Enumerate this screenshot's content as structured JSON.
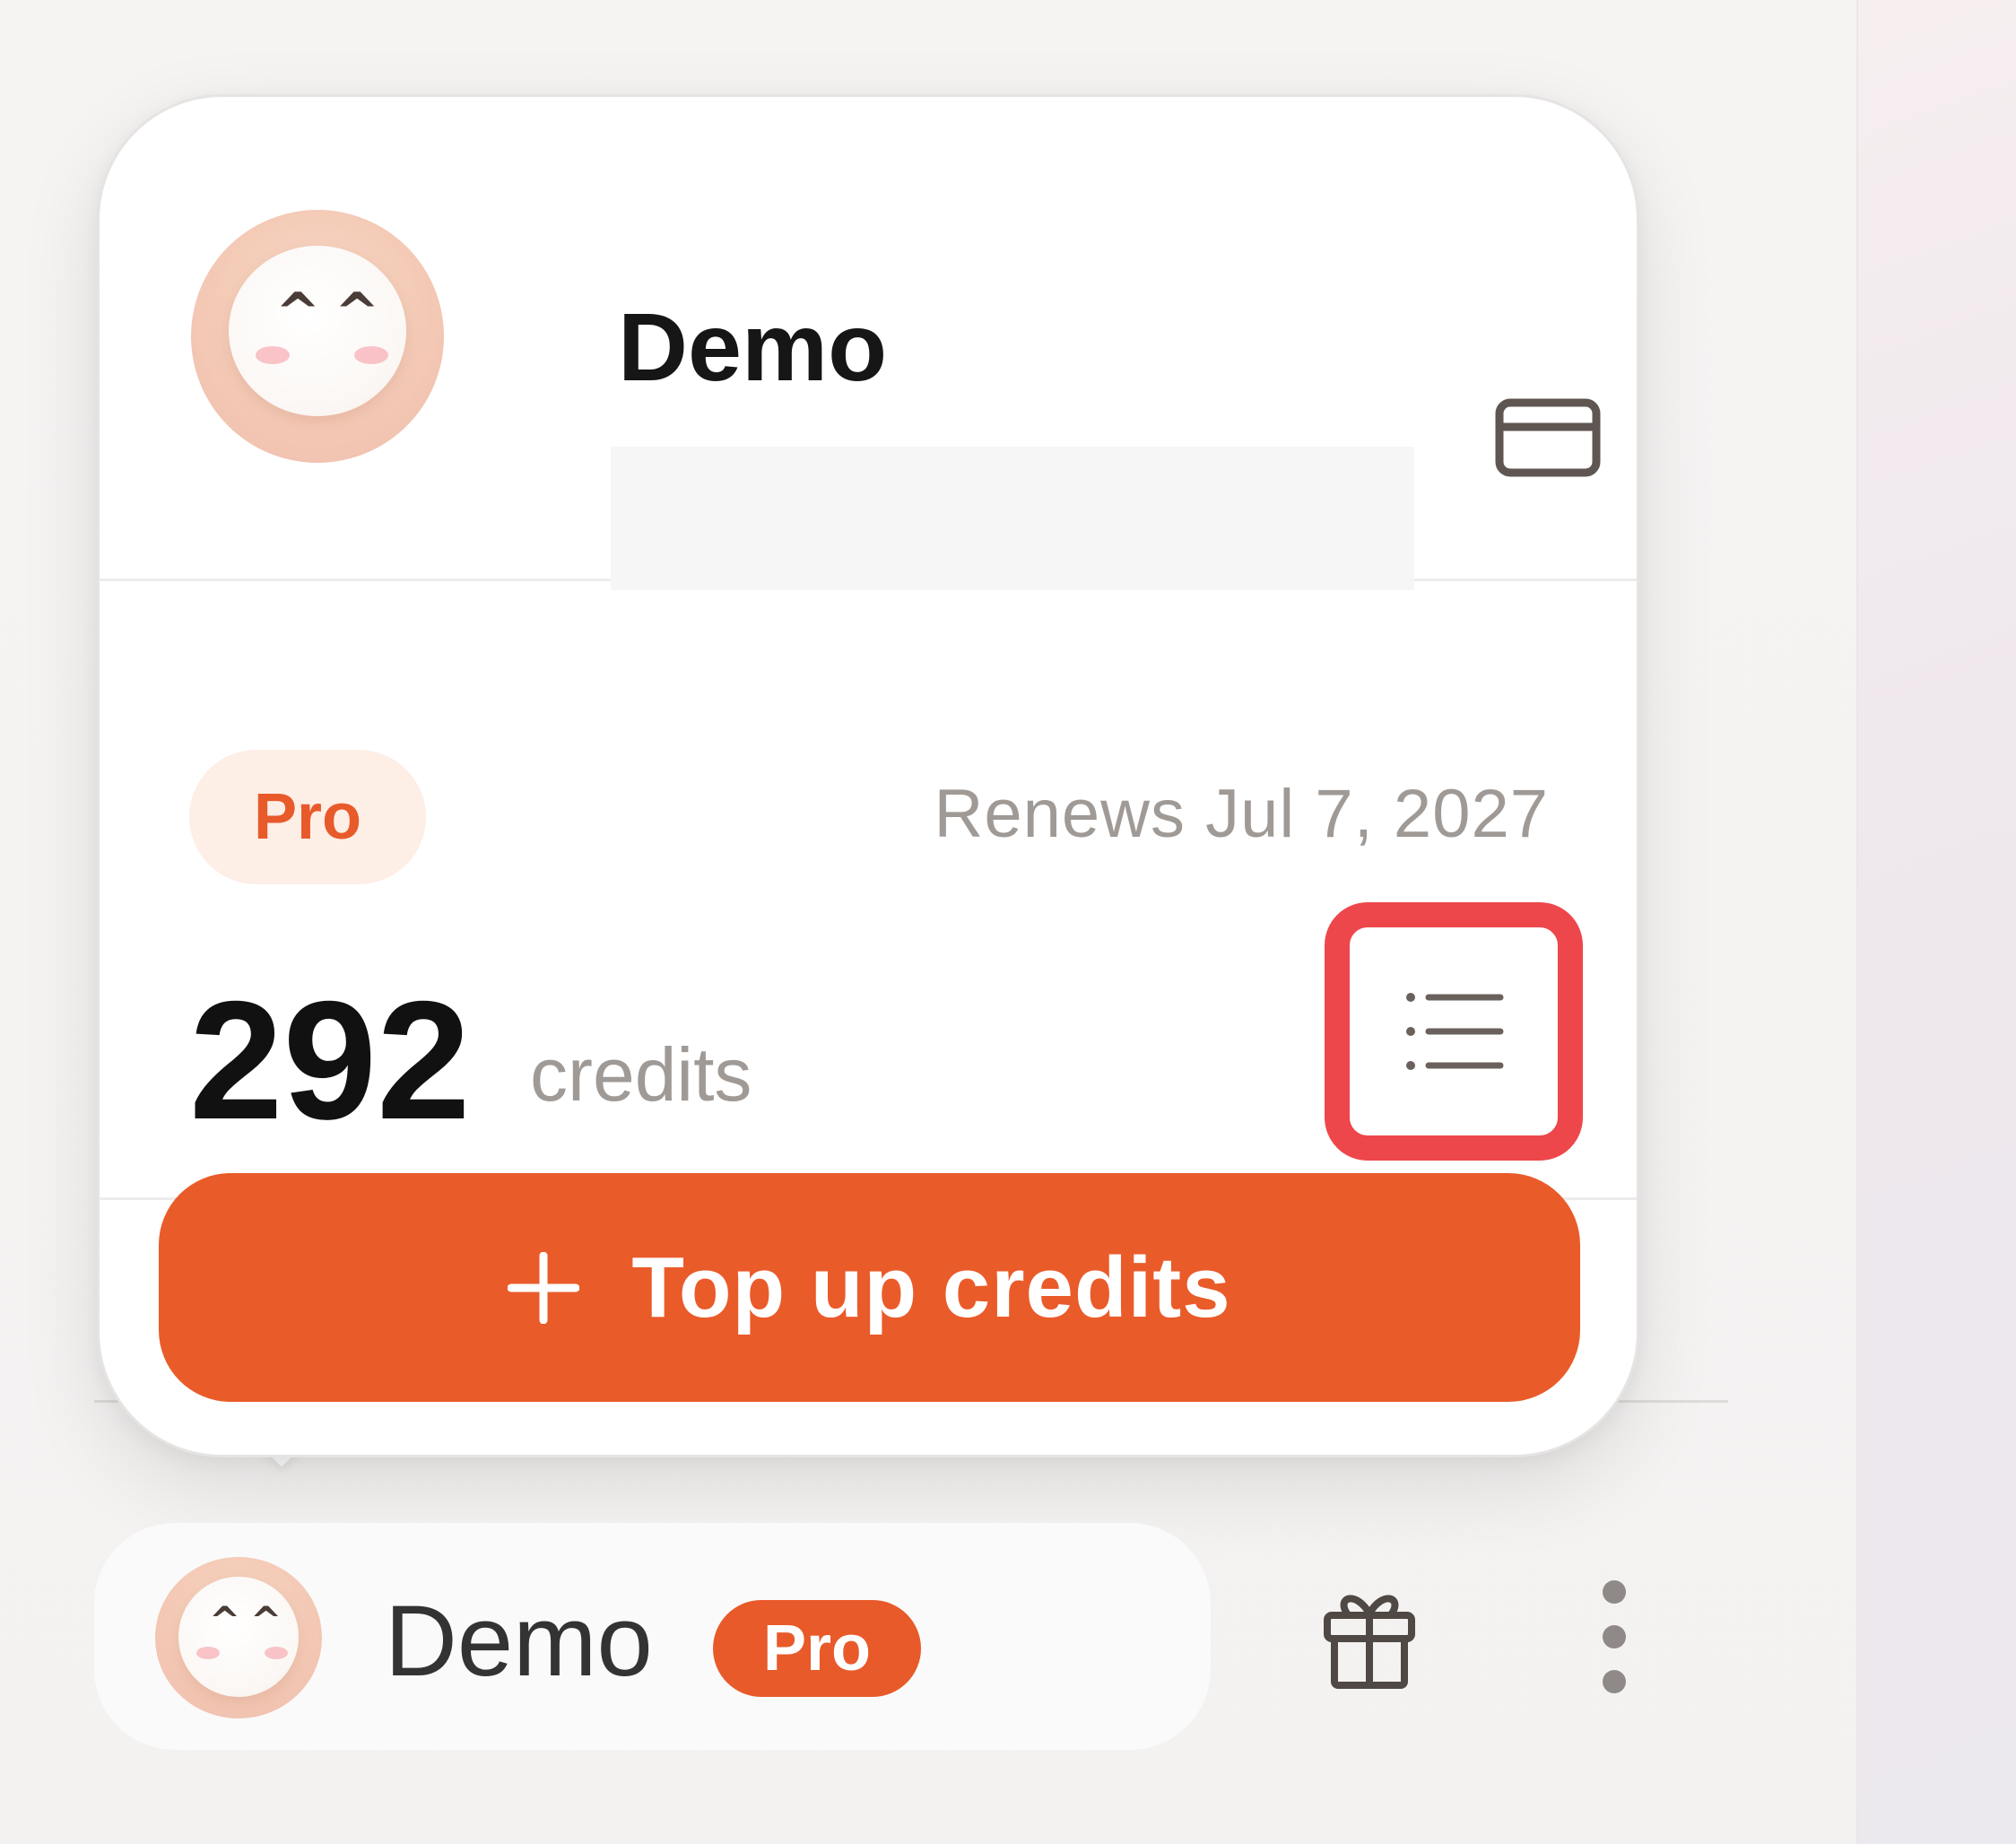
{
  "account_popover": {
    "display_name": "Demo",
    "plan_badge": "Pro",
    "renewal_text": "Renews Jul 7, 2027",
    "credits_count": "292",
    "credits_unit": "credits",
    "top_up_label": "Top up credits",
    "icons": {
      "billing": "credit-card-icon",
      "history": "list-icon",
      "top_up": "plus-icon"
    }
  },
  "user_row": {
    "name": "Demo",
    "plan_badge": "Pro",
    "icons": {
      "gift": "gift-icon",
      "more": "more-vertical-icon"
    }
  },
  "colors": {
    "accent": "#EA5B2A",
    "badge_bg": "#FDEEE6",
    "highlight": "#EE474B"
  }
}
